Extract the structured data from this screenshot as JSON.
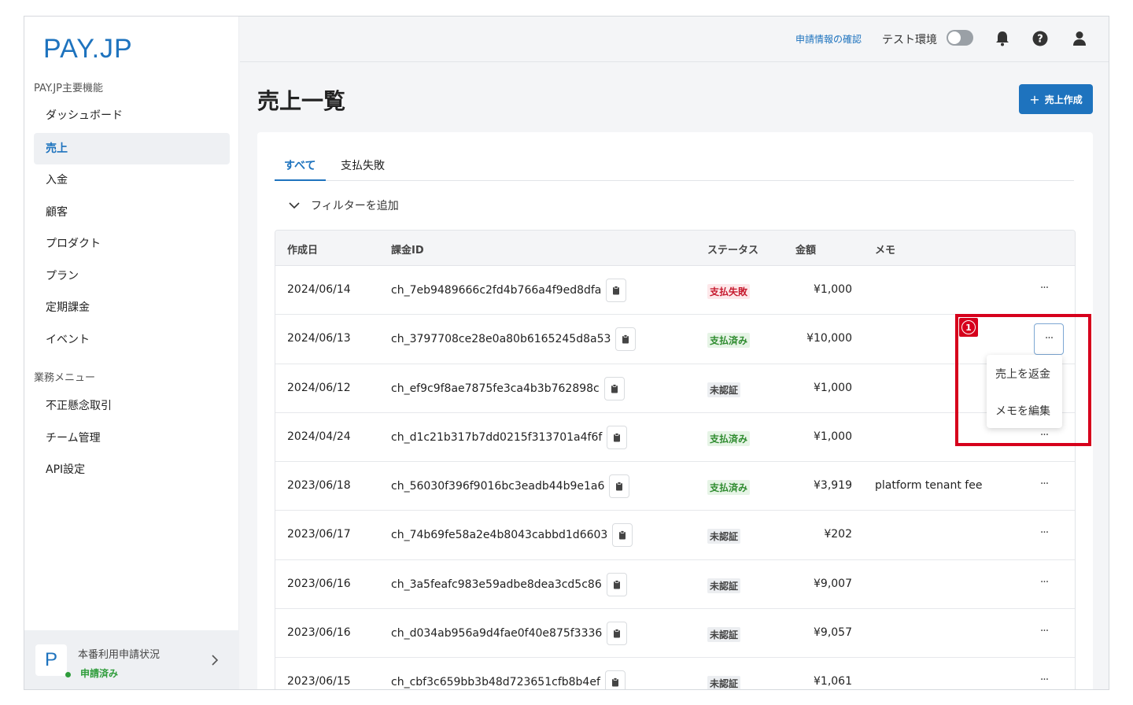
{
  "brand": {
    "logo_text": "PAY.JP",
    "accent": "#1e73be"
  },
  "sidebar": {
    "section1": "PAY.JP主要機能",
    "items": [
      {
        "label": "ダッシュボード"
      },
      {
        "label": "売上",
        "active": true
      },
      {
        "label": "入金"
      },
      {
        "label": "顧客"
      },
      {
        "label": "プロダクト"
      },
      {
        "label": "プラン"
      },
      {
        "label": "定期課金"
      },
      {
        "label": "イベント"
      }
    ],
    "section2": "業務メニュー",
    "items2": [
      {
        "label": "不正懸念取引"
      },
      {
        "label": "チーム管理"
      },
      {
        "label": "API設定"
      }
    ],
    "status_card": {
      "avatar_letter": "P",
      "title": "本番利用申請状況",
      "state": "申請済み"
    }
  },
  "topbar": {
    "link": "申請情報の確認",
    "env_label": "テスト環境",
    "icons": [
      "bell-icon",
      "help-icon",
      "user-icon"
    ]
  },
  "page": {
    "title": "売上一覧",
    "create_button": "売上作成"
  },
  "tabs": [
    {
      "label": "すべて",
      "active": true
    },
    {
      "label": "支払失敗"
    }
  ],
  "filter": {
    "label": "フィルターを追加"
  },
  "table": {
    "headers": {
      "date": "作成日",
      "id": "課金ID",
      "status": "ステータス",
      "amount": "金額",
      "memo": "メモ"
    },
    "rows": [
      {
        "date": "2024/06/14",
        "id": "ch_7eb9489666c2fd4b766a4f9ed8dfa",
        "status": "支払失敗",
        "status_kind": "fail",
        "amount": "¥1,000",
        "memo": ""
      },
      {
        "date": "2024/06/13",
        "id": "ch_3797708ce28e0a80b6165245d8a53",
        "status": "支払済み",
        "status_kind": "paid",
        "amount": "¥10,000",
        "memo": ""
      },
      {
        "date": "2024/06/12",
        "id": "ch_ef9c9f8ae7875fe3ca4b3b762898c",
        "status": "未認証",
        "status_kind": "unauth",
        "amount": "¥1,000",
        "memo": ""
      },
      {
        "date": "2024/04/24",
        "id": "ch_d1c21b317b7dd0215f313701a4f6f",
        "status": "支払済み",
        "status_kind": "paid",
        "amount": "¥1,000",
        "memo": ""
      },
      {
        "date": "2023/06/18",
        "id": "ch_56030f396f9016bc3eadb44b9e1a6",
        "status": "支払済み",
        "status_kind": "paid",
        "amount": "¥3,919",
        "memo": "platform tenant fee"
      },
      {
        "date": "2023/06/17",
        "id": "ch_74b69fe58a2e4b8043cabbd1d6603",
        "status": "未認証",
        "status_kind": "unauth",
        "amount": "¥202",
        "memo": ""
      },
      {
        "date": "2023/06/16",
        "id": "ch_3a5feafc983e59adbe8dea3cd5c86",
        "status": "未認証",
        "status_kind": "unauth",
        "amount": "¥9,007",
        "memo": ""
      },
      {
        "date": "2023/06/16",
        "id": "ch_d034ab956a9d4fae0f40e875f3336",
        "status": "未認証",
        "status_kind": "unauth",
        "amount": "¥9,057",
        "memo": ""
      },
      {
        "date": "2023/06/15",
        "id": "ch_cbf3c659bb3b48d723651cfb8b4ef",
        "status": "未認証",
        "status_kind": "unauth",
        "amount": "¥1,061",
        "memo": ""
      }
    ],
    "more_label": "···"
  },
  "context_menu": {
    "items": [
      "売上を返金",
      "メモを編集"
    ]
  },
  "annotation": {
    "number": "1",
    "color": "#d6001c"
  }
}
